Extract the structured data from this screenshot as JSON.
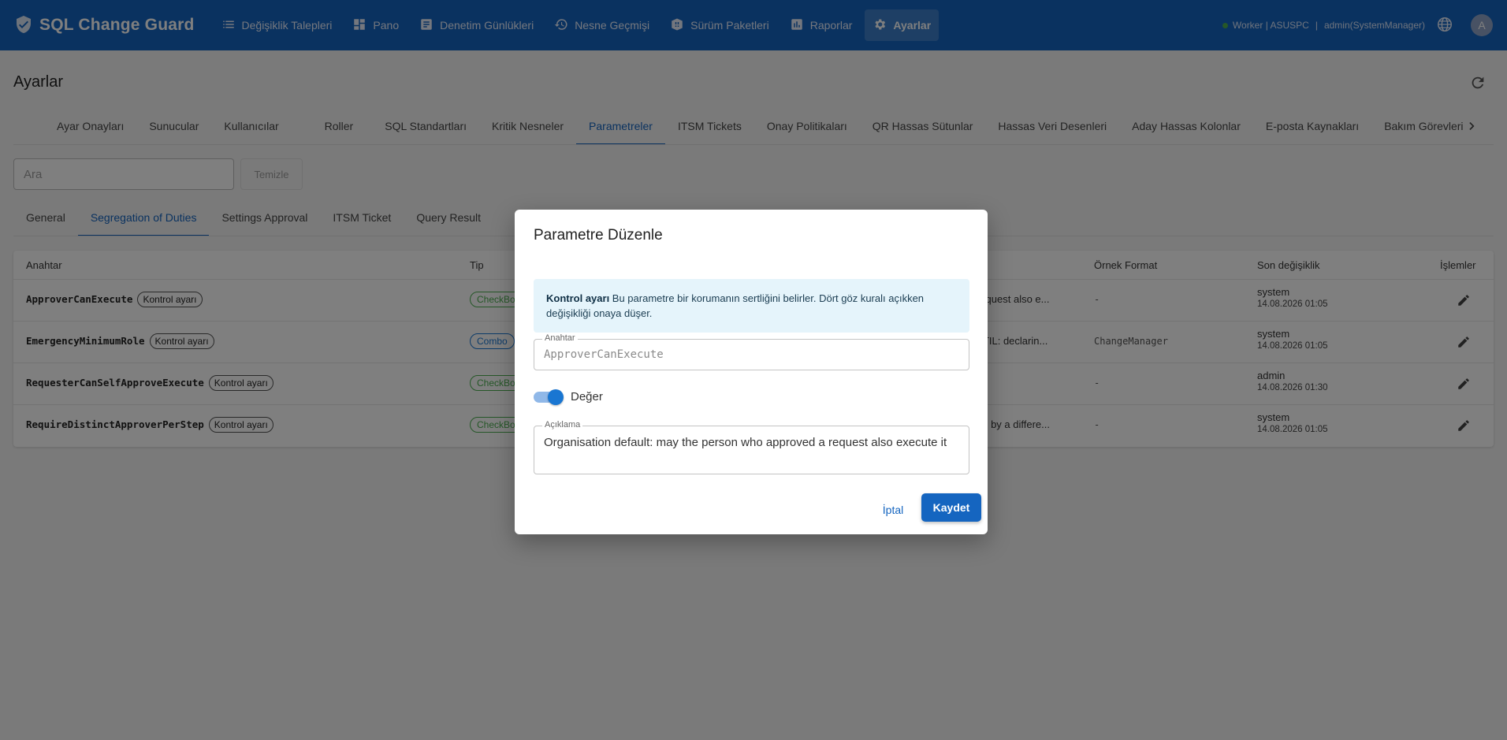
{
  "app": {
    "title": "SQL Change Guard",
    "nav": [
      {
        "label": "Değişiklik Talepleri",
        "icon": "list-icon"
      },
      {
        "label": "Pano",
        "icon": "dashboard-icon"
      },
      {
        "label": "Denetim Günlükleri",
        "icon": "audit-log-icon"
      },
      {
        "label": "Nesne Geçmişi",
        "icon": "history-icon"
      },
      {
        "label": "Sürüm Paketleri",
        "icon": "package-icon"
      },
      {
        "label": "Raporlar",
        "icon": "chart-icon"
      },
      {
        "label": "Ayarlar",
        "icon": "gear-icon",
        "active": true
      }
    ],
    "worker": "Worker | ASUSPC",
    "separator": "|",
    "user": "admin(SystemManager)",
    "avatar": "A"
  },
  "page": {
    "title": "Ayarlar",
    "tabs": [
      "Ayar Onayları",
      "Sunucular",
      "Kullanıcılar",
      "Roller",
      "SQL Standartları",
      "Kritik Nesneler",
      "Parametreler",
      "ITSM Tickets",
      "Onay Politikaları",
      "QR Hassas Sütunlar",
      "Hassas Veri Desenleri",
      "Aday Hassas Kolonlar",
      "E-posta Kaynakları",
      "Bakım Görevleri"
    ],
    "active_tab": "Parametreler",
    "search_placeholder": "Ara",
    "clear_label": "Temizle",
    "subtabs": [
      "General",
      "Segregation of Duties",
      "Settings Approval",
      "ITSM Ticket",
      "Query Result"
    ],
    "active_subtab": "Segregation of Duties"
  },
  "table": {
    "headers": {
      "key": "Anahtar",
      "type": "Tip",
      "format": "Örnek Format",
      "changed": "Son değişiklik",
      "actions": "İşlemler"
    },
    "rows": [
      {
        "key": "ApproverCanExecute",
        "chip": "Kontrol ayarı",
        "type": "CheckBo",
        "desc": "request also e...",
        "format": "-",
        "who": "system",
        "when": "14.08.2026 01:05"
      },
      {
        "key": "EmergencyMinimumRole",
        "chip": "Kontrol ayarı",
        "type": "Combo",
        "desc": "(ITIL: declarin...",
        "format": "ChangeManager",
        "who": "system",
        "when": "14.08.2026 01:05"
      },
      {
        "key": "RequesterCanSelfApproveExecute",
        "chip": "Kontrol ayarı",
        "type": "CheckBo",
        "desc": "",
        "format": "-",
        "who": "admin",
        "when": "14.08.2026 01:30"
      },
      {
        "key": "RequireDistinctApproverPerStep",
        "chip": "Kontrol ayarı",
        "type": "CheckBo",
        "desc": "ed by a differe...",
        "format": "-",
        "who": "system",
        "when": "14.08.2026 01:05"
      }
    ]
  },
  "dialog": {
    "title": "Parametre Düzenle",
    "info_bold": "Kontrol ayarı",
    "info_text": " Bu parametre bir korumanın sertliğini belirler. Dört göz kuralı açıkken değişikliği onaya düşer.",
    "key_label": "Anahtar",
    "key_value": "ApproverCanExecute",
    "toggle_label": "Değer",
    "toggle_on": true,
    "desc_label": "Açıklama",
    "desc_value": "Organisation default: may the person who approved a request also execute it",
    "cancel": "İptal",
    "save": "Kaydet"
  },
  "colors": {
    "primary": "#1565c0",
    "info_bg": "#e5f4fb",
    "status_ok": "#4caf50"
  }
}
